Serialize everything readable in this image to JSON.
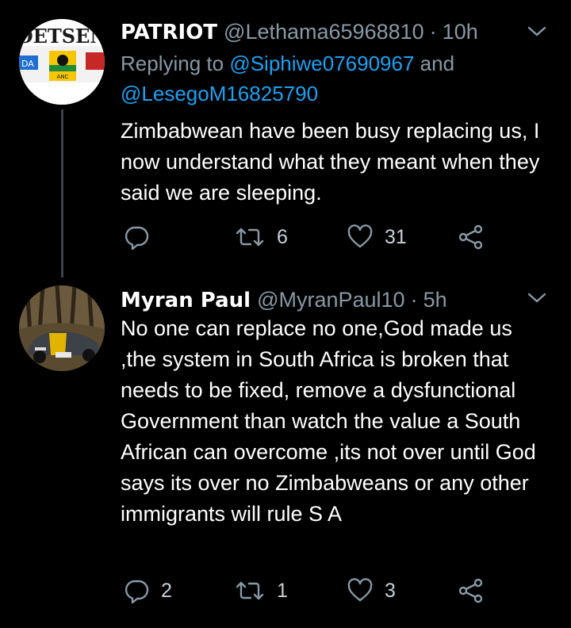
{
  "tweets": [
    {
      "display_name": "PATRIOT",
      "handle": "@Lethama65968810",
      "separator": "·",
      "time": "10h",
      "replying_prefix": "Replying to",
      "replying_handle_1": "@Siphiwe07690967",
      "replying_and": "and",
      "replying_handle_2": "@LesegoM16825790",
      "text": "Zimbabwean have been busy replacing us, I now understand what they meant when they said we are sleeping.",
      "avatar_text": "OETSEN",
      "avatar_badge": "ANC",
      "avatar_left_text": "DA",
      "actions": {
        "replies": "",
        "retweets": "6",
        "likes": "31"
      }
    },
    {
      "display_name": "Myran Paul",
      "handle": "@MyranPaul10",
      "separator": "·",
      "time": "5h",
      "text": "No one can replace no one,God made us ,the system in South Africa is broken that needs to be fixed, remove a dysfunctional Government than watch the value a South African can overcome ,its not over until God says its over no Zimbabweans or any other immigrants will rule S A",
      "actions": {
        "replies": "2",
        "retweets": "1",
        "likes": "3"
      }
    }
  ],
  "colors": {
    "background": "#000000",
    "text": "#ffffff",
    "secondary": "#8899a6",
    "link": "#1da1f2",
    "thread_line": "#38444d"
  },
  "icons": [
    "reply-icon",
    "retweet-icon",
    "like-icon",
    "share-icon",
    "chevron-down-icon"
  ]
}
